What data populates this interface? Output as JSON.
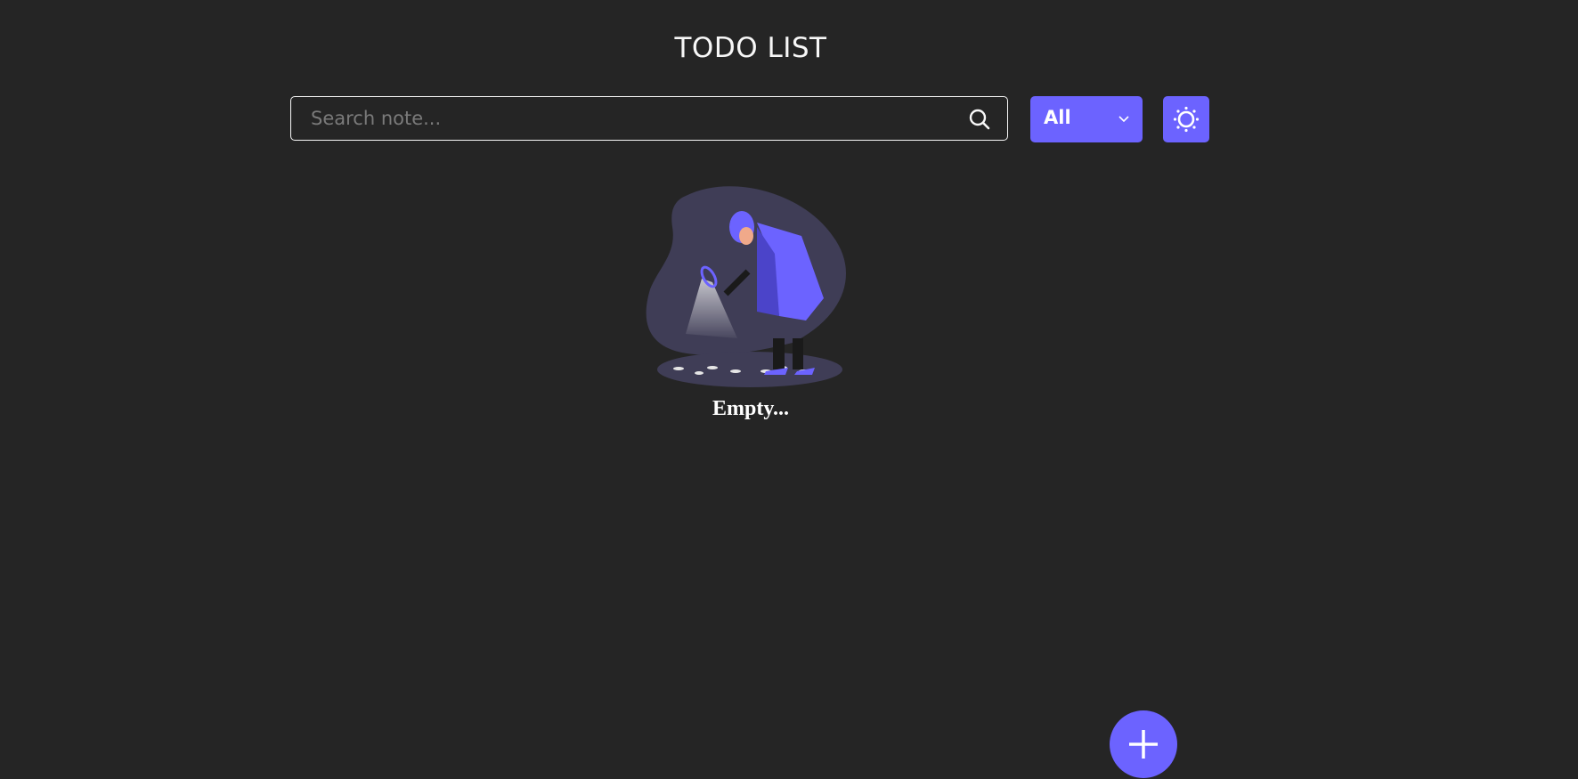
{
  "header": {
    "title": "TODO LIST"
  },
  "search": {
    "placeholder": "Search note...",
    "value": "",
    "icon": "search-icon"
  },
  "filter": {
    "selected": "All",
    "icon": "chevron-down-icon"
  },
  "theme_toggle": {
    "icon": "sun-icon"
  },
  "empty_state": {
    "text": "Empty...",
    "illustration": "detective-illustration"
  },
  "fab": {
    "icon": "plus-icon"
  },
  "colors": {
    "accent": "#6c63ff",
    "background": "#252525",
    "text": "#f7f7f7"
  }
}
